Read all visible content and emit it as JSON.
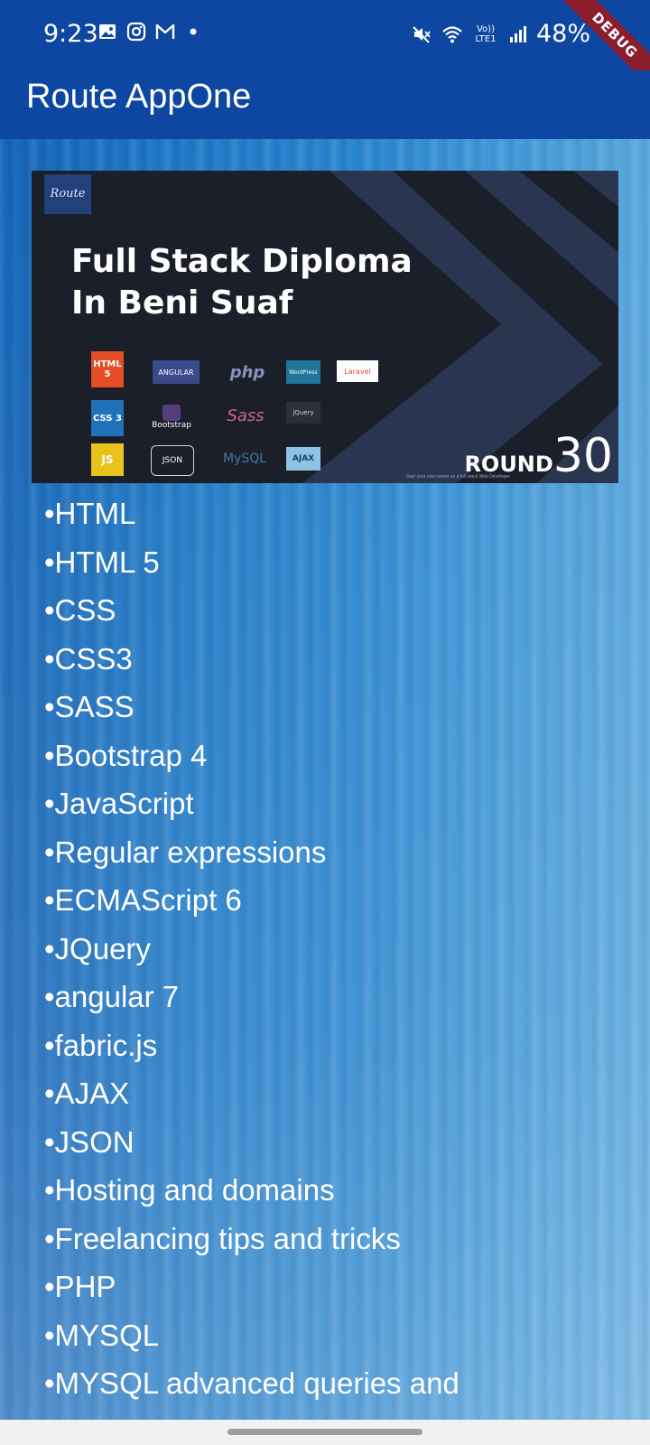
{
  "status_bar": {
    "time": "9:23",
    "left_icons": [
      "gallery-icon",
      "instagram-icon",
      "gmail-icon",
      "notification-dot-icon"
    ],
    "right_icons": [
      "mute-icon",
      "wifi-icon",
      "volte-lte1-icon",
      "signal-icon"
    ],
    "volte_label": "Vo)) LTE1",
    "battery": "48%",
    "debug_label": "DEBUG"
  },
  "app_bar": {
    "title": "Route AppOne"
  },
  "banner": {
    "logo": "Route",
    "title": "Full Stack Diploma\nIn Beni Suaf",
    "tech_badges": [
      "HTML 5",
      "ANGULAR",
      "php",
      "WordPress",
      "Laravel",
      "CSS 3",
      "Bootstrap",
      "Sass",
      "jQuery",
      "JS",
      "JSON",
      "MySQL",
      "AJAX"
    ],
    "round_label": "ROUND",
    "round_number": "30",
    "round_sub": "Start your new career as a full stack Web Developer",
    "colors": {
      "background": "#1b1f2a",
      "accent": "#2a3550"
    }
  },
  "topics": [
    "•HTML",
    "•HTML 5",
    "•CSS",
    "•CSS3",
    "•SASS",
    "•Bootstrap 4",
    "•JavaScript",
    "•Regular expressions",
    "•ECMAScript 6",
    "•JQuery",
    "•angular 7",
    "•fabric.js",
    "•AJAX",
    "•JSON",
    "•Hosting and domains",
    "•Freelancing tips and tricks",
    "•PHP",
    "•MYSQL",
    "•MYSQL advanced queries and"
  ],
  "colors": {
    "app_bar": "#0d47a1",
    "text": "#ffffff"
  }
}
